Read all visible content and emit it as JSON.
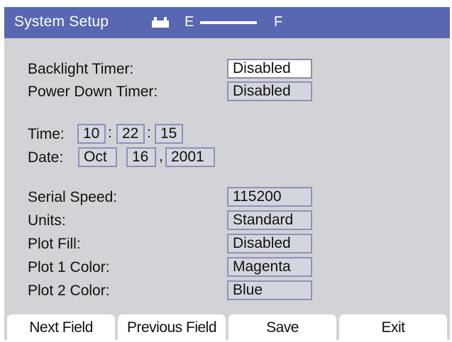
{
  "titlebar": {
    "title": "System Setup",
    "fuel_icon": "battery-icon",
    "fuel_empty_label": "E",
    "fuel_full_label": "F",
    "fuel_level": 0.5
  },
  "settings": {
    "backlight_timer": {
      "label": "Backlight Timer:",
      "value": "Disabled"
    },
    "power_down_timer": {
      "label": "Power Down Timer:",
      "value": "Disabled"
    },
    "time": {
      "label": "Time:",
      "hour": "10",
      "minute": "22",
      "second": "15",
      "separator": ":"
    },
    "date": {
      "label": "Date:",
      "month": "Oct",
      "day": "16",
      "year": "2001",
      "separator": ","
    },
    "serial_speed": {
      "label": "Serial Speed:",
      "value": "115200"
    },
    "units": {
      "label": "Units:",
      "value": "Standard"
    },
    "plot_fill": {
      "label": "Plot Fill:",
      "value": "Disabled"
    },
    "plot1_color": {
      "label": "Plot 1 Color:",
      "value": "Magenta"
    },
    "plot2_color": {
      "label": "Plot 2 Color:",
      "value": "Blue"
    }
  },
  "softkeys": {
    "next_field": "Next Field",
    "previous_field": "Previous Field",
    "save": "Save",
    "exit": "Exit"
  },
  "colors": {
    "titlebar": "#5767b2",
    "screen_background": "#d2d3d6",
    "field_border": "#8d91b8",
    "active_field": "#ffffff"
  }
}
